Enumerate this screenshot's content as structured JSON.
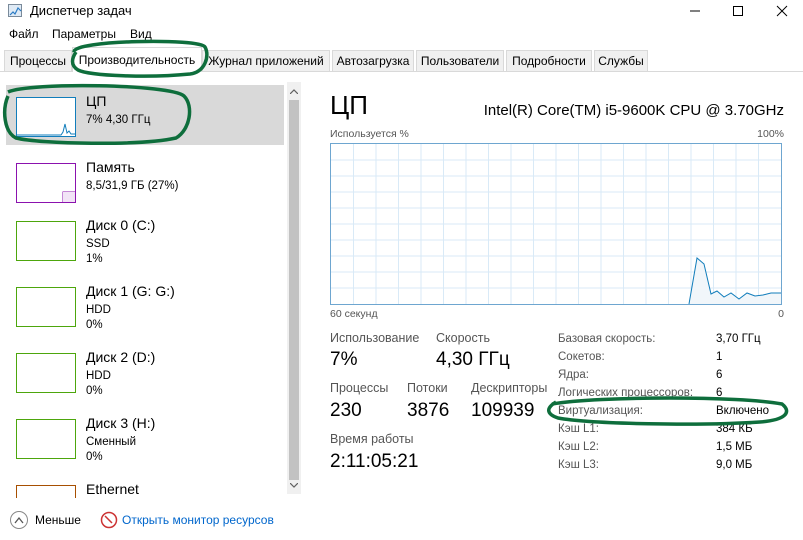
{
  "window": {
    "title": "Диспетчер задач",
    "icon": "task-manager-icon"
  },
  "menu": [
    "Файл",
    "Параметры",
    "Вид"
  ],
  "tabs": [
    {
      "label": "Процессы"
    },
    {
      "label": "Производительность",
      "active": true
    },
    {
      "label": "Журнал приложений"
    },
    {
      "label": "Автозагрузка"
    },
    {
      "label": "Пользователи"
    },
    {
      "label": "Подробности"
    },
    {
      "label": "Службы"
    }
  ],
  "resources": [
    {
      "name": "ЦП",
      "sub1": "7% 4,30 ГГц",
      "sub2": "",
      "selected": true,
      "color": "#117dbb"
    },
    {
      "name": "Память",
      "sub1": "8,5/31,9 ГБ (27%)",
      "sub2": "",
      "color": "#8b12ae"
    },
    {
      "name": "Диск 0 (C:)",
      "sub1": "SSD",
      "sub2": "1%",
      "color": "#4da60c"
    },
    {
      "name": "Диск 1 (G: G:)",
      "sub1": "HDD",
      "sub2": "0%",
      "color": "#4da60c"
    },
    {
      "name": "Диск 2 (D:)",
      "sub1": "HDD",
      "sub2": "0%",
      "color": "#4da60c"
    },
    {
      "name": "Диск 3 (H:)",
      "sub1": "Сменный",
      "sub2": "0%",
      "color": "#4da60c"
    },
    {
      "name": "Ethernet",
      "sub1": "",
      "sub2": "",
      "color": "#a74f01"
    }
  ],
  "detail": {
    "title": "ЦП",
    "model": "Intel(R) Core(TM) i5-9600K CPU @ 3.70GHz",
    "chart_label_top_left": "Используется %",
    "chart_label_top_right": "100%",
    "chart_label_bottom_left": "60 секунд",
    "chart_label_bottom_right": "0",
    "chart_color": "#117dbb",
    "stats": {
      "usage_label": "Использование",
      "usage_value": "7%",
      "speed_label": "Скорость",
      "speed_value": "4,30 ГГц",
      "processes_label": "Процессы",
      "processes_value": "230",
      "threads_label": "Потоки",
      "threads_value": "3876",
      "handles_label": "Дескрипторы",
      "handles_value": "109939",
      "uptime_label": "Время работы",
      "uptime_value": "2:11:05:21"
    },
    "specs": [
      {
        "label": "Базовая скорость:",
        "value": "3,70 ГГц"
      },
      {
        "label": "Сокетов:",
        "value": "1"
      },
      {
        "label": "Ядра:",
        "value": "6"
      },
      {
        "label": "Логических процессоров:",
        "value": "6"
      },
      {
        "label": "Виртуализация:",
        "value": "Включено"
      },
      {
        "label": "Кэш L1:",
        "value": "384 КБ"
      },
      {
        "label": "Кэш L2:",
        "value": "1,5 МБ"
      },
      {
        "label": "Кэш L3:",
        "value": "9,0 МБ"
      }
    ]
  },
  "footer": {
    "less_label": "Меньше",
    "monitor_label": "Открыть монитор ресурсов"
  },
  "annotation_color": "#0e6e3c"
}
